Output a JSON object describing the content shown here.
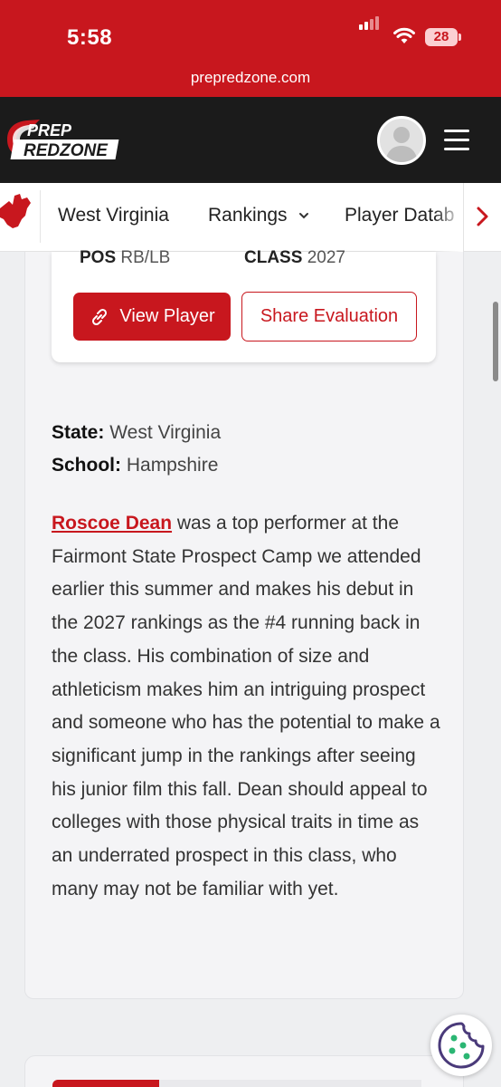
{
  "status_bar": {
    "time": "5:58",
    "battery": "28"
  },
  "browser": {
    "url": "prepredzone.com"
  },
  "header": {
    "logo_line1": "PREP",
    "logo_line2": "REDZONE"
  },
  "subnav": {
    "items": [
      {
        "label": "West Virginia"
      },
      {
        "label": "Rankings"
      },
      {
        "label": "Player Datab"
      }
    ]
  },
  "player_card": {
    "pos_label": "POS",
    "pos_value": "RB/LB",
    "class_label": "CLASS",
    "class_value": "2027",
    "view_button": "View Player",
    "share_button": "Share Evaluation"
  },
  "meta": {
    "state_label": "State:",
    "state_value": "West Virginia",
    "school_label": "School:",
    "school_value": "Hampshire"
  },
  "article": {
    "player_name": "Roscoe Dean",
    "text": " was a top performer at the Fairmont State Prospect Camp we attended earlier this summer and makes his debut in the 2027 rankings as the #4 running back in the class. His combination of size and athleticism makes him an intriguing prospect and someone who has the potential to make a significant jump in the rankings after seeing his junior film this fall. Dean should appeal to colleges with those physical traits in time as an underrated prospect in this class, who many may not be familiar with yet."
  },
  "colors": {
    "brand_red": "#c8171e",
    "header_dark": "#1b1b1b"
  }
}
